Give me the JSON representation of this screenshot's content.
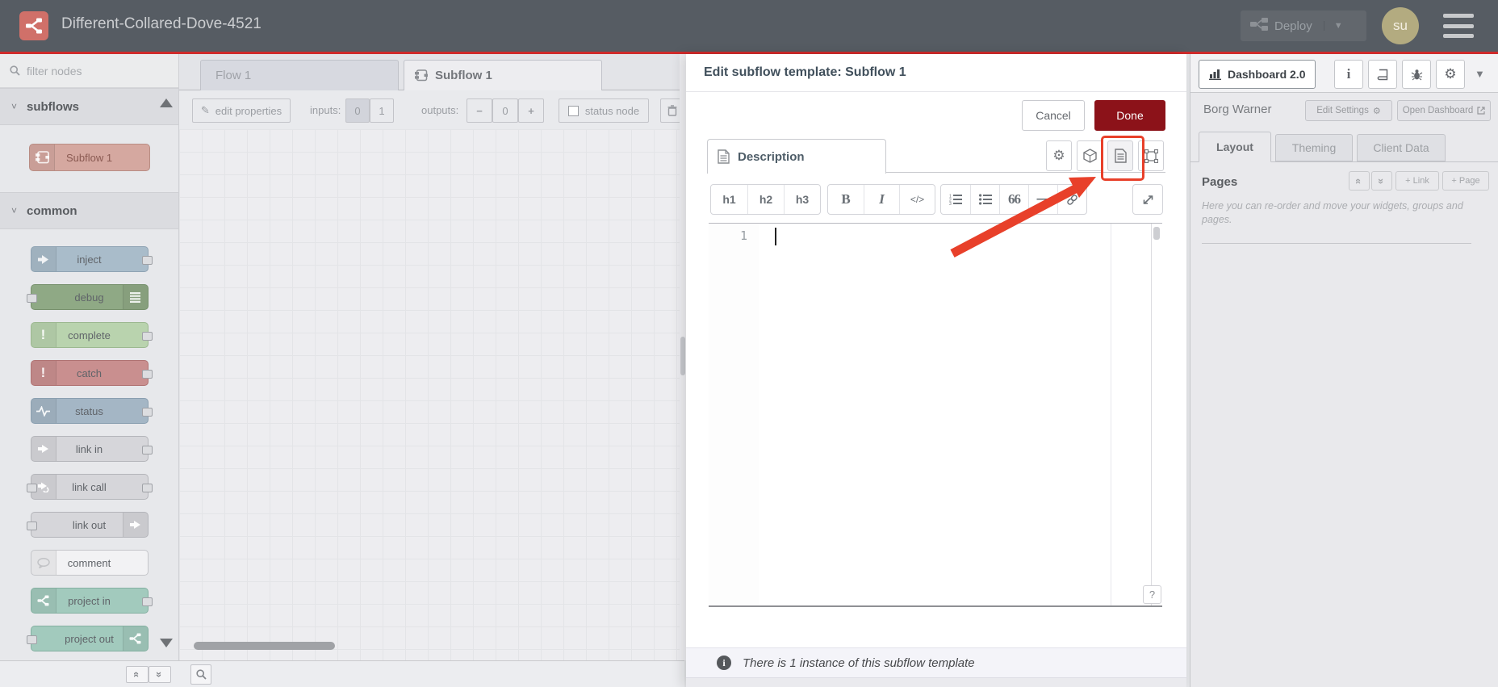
{
  "header": {
    "title": "Different-Collared-Dove-4521",
    "deploy_label": "Deploy",
    "avatar_initials": "su",
    "accent_red": "#cf2b2b"
  },
  "palette": {
    "filter_placeholder": "filter nodes",
    "sections": [
      {
        "label": "subflows",
        "nodes": [
          {
            "label": "Subflow 1",
            "color": "#d5a8a0",
            "border": "#b98d84",
            "icon": "subflow-icon",
            "iconSide": "left",
            "ports": [],
            "wide": true
          }
        ]
      },
      {
        "label": "common",
        "nodes": [
          {
            "label": "inject",
            "color": "#a9bcca",
            "border": "#8fa3b3",
            "icon": "inject-icon",
            "iconSide": "left",
            "ports": [
              "right"
            ]
          },
          {
            "label": "debug",
            "color": "#8fa985",
            "border": "#78916e",
            "icon": "debug-icon",
            "iconSide": "right",
            "ports": [
              "left"
            ]
          },
          {
            "label": "complete",
            "color": "#b9d3ae",
            "border": "#9cb890",
            "icon": "exclamation-icon",
            "iconSide": "left",
            "ports": [
              "right"
            ]
          },
          {
            "label": "catch",
            "color": "#c98f8f",
            "border": "#b07373",
            "icon": "exclamation-icon",
            "iconSide": "left",
            "ports": [
              "right"
            ]
          },
          {
            "label": "status",
            "color": "#a4b6c5",
            "border": "#8a9fb0",
            "icon": "status-icon",
            "iconSide": "left",
            "ports": [
              "right"
            ]
          },
          {
            "label": "link in",
            "color": "#d6d6da",
            "border": "#b4b5ba",
            "icon": "link-in-icon",
            "iconSide": "left",
            "ports": [
              "right"
            ]
          },
          {
            "label": "link call",
            "color": "#d6d6da",
            "border": "#b4b5ba",
            "icon": "link-call-icon",
            "iconSide": "left",
            "ports": [
              "left",
              "right"
            ]
          },
          {
            "label": "link out",
            "color": "#d6d6da",
            "border": "#b4b5ba",
            "icon": "link-out-icon",
            "iconSide": "right",
            "ports": [
              "left"
            ]
          },
          {
            "label": "comment",
            "color": "#f2f2f4",
            "border": "#c4c5c9",
            "icon": "comment-icon",
            "iconSide": "left",
            "ports": []
          },
          {
            "label": "project in",
            "color": "#a2cabd",
            "border": "#84b0a1",
            "icon": "nodered-icon",
            "iconSide": "left",
            "ports": [
              "right"
            ]
          },
          {
            "label": "project out",
            "color": "#a2cabd",
            "border": "#84b0a1",
            "icon": "nodered-icon",
            "iconSide": "right",
            "ports": [
              "left"
            ]
          }
        ]
      }
    ]
  },
  "workspace": {
    "tabs": [
      {
        "label": "Flow 1"
      },
      {
        "label": "Subflow 1"
      }
    ],
    "toolbar": {
      "edit_properties": "edit properties",
      "inputs_label": "inputs:",
      "inputs_options": [
        "0",
        "1"
      ],
      "inputs_selected": "0",
      "outputs_label": "outputs:",
      "outputs_minus": "−",
      "outputs_value": "0",
      "outputs_plus": "+",
      "status_node_label": "status node"
    }
  },
  "tray": {
    "title": "Edit subflow template: Subflow 1",
    "cancel_label": "Cancel",
    "done_label": "Done",
    "done_color": "#8c1219",
    "tab_label": "Description",
    "md_toolbar": {
      "headings": [
        "h1",
        "h2",
        "h3"
      ],
      "inline": [
        "B",
        "I",
        "</>"
      ],
      "blocks": [
        "ordered-list",
        "unordered-list",
        "quote",
        "hr",
        "link"
      ]
    },
    "editor": {
      "line_number": "1",
      "content": ""
    },
    "help_label": "?",
    "footer_text": "There is 1 instance of this subflow template"
  },
  "sidebar": {
    "tab_label": "Dashboard 2.0",
    "project_name": "Borg Warner",
    "edit_settings_label": "Edit Settings",
    "open_dashboard_label": "Open Dashboard",
    "tabs": [
      "Layout",
      "Theming",
      "Client Data"
    ],
    "active_tab": "Layout",
    "pages_title": "Pages",
    "link_button": "+ Link",
    "page_button": "+ Page",
    "pages_hint": "Here you can re-order and move your widgets, groups and pages."
  },
  "annotation": {
    "color": "#e8402a",
    "highlight_target": "description-icon-button"
  }
}
